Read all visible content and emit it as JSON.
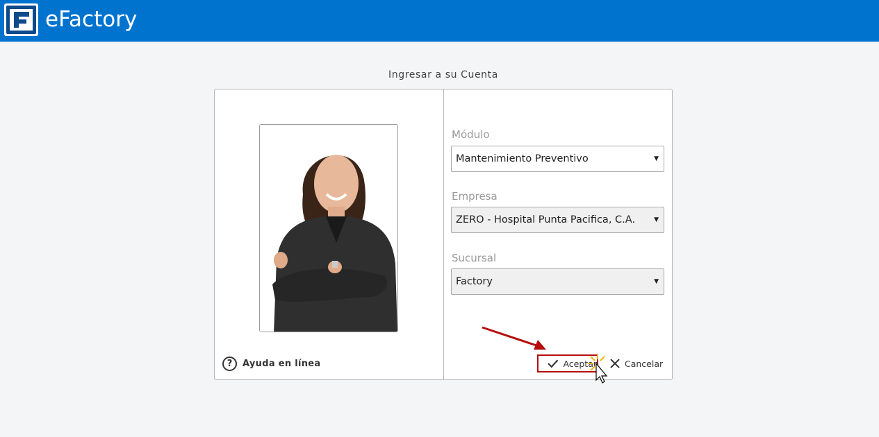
{
  "header": {
    "app_name": "eFactory",
    "logo_icon": "efactory-logo-icon",
    "bar_color": "#0073cf"
  },
  "login": {
    "title": "Ingresar a su Cuenta",
    "photo": "user-avatar-photo",
    "help_label": "Ayuda en línea",
    "help_icon": "question-circle-icon",
    "fields": {
      "module_label": "Módulo",
      "module_value": "Mantenimiento Preventivo",
      "company_label": "Empresa",
      "company_value": "ZERO - Hospital Punta Pacifica, C.A.",
      "branch_label": "Sucursal",
      "branch_value": "Factory"
    },
    "accept_label": "Aceptar",
    "cancel_label": "Cancelar",
    "highlight_color": "#b50d0d"
  }
}
